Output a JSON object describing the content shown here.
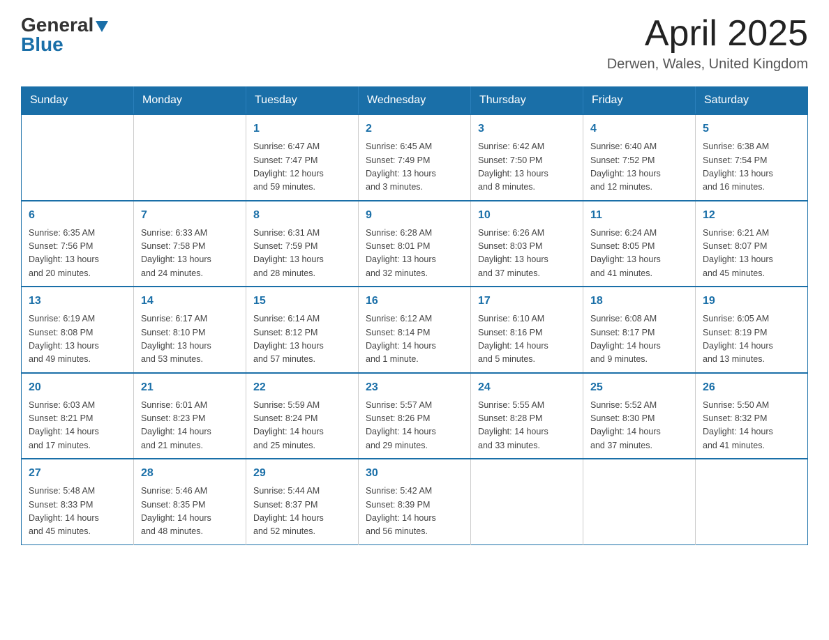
{
  "header": {
    "logo": {
      "general": "General",
      "blue": "Blue"
    },
    "title": "April 2025",
    "location": "Derwen, Wales, United Kingdom"
  },
  "calendar": {
    "days_of_week": [
      "Sunday",
      "Monday",
      "Tuesday",
      "Wednesday",
      "Thursday",
      "Friday",
      "Saturday"
    ],
    "weeks": [
      [
        {
          "day": "",
          "info": ""
        },
        {
          "day": "",
          "info": ""
        },
        {
          "day": "1",
          "info": "Sunrise: 6:47 AM\nSunset: 7:47 PM\nDaylight: 12 hours\nand 59 minutes."
        },
        {
          "day": "2",
          "info": "Sunrise: 6:45 AM\nSunset: 7:49 PM\nDaylight: 13 hours\nand 3 minutes."
        },
        {
          "day": "3",
          "info": "Sunrise: 6:42 AM\nSunset: 7:50 PM\nDaylight: 13 hours\nand 8 minutes."
        },
        {
          "day": "4",
          "info": "Sunrise: 6:40 AM\nSunset: 7:52 PM\nDaylight: 13 hours\nand 12 minutes."
        },
        {
          "day": "5",
          "info": "Sunrise: 6:38 AM\nSunset: 7:54 PM\nDaylight: 13 hours\nand 16 minutes."
        }
      ],
      [
        {
          "day": "6",
          "info": "Sunrise: 6:35 AM\nSunset: 7:56 PM\nDaylight: 13 hours\nand 20 minutes."
        },
        {
          "day": "7",
          "info": "Sunrise: 6:33 AM\nSunset: 7:58 PM\nDaylight: 13 hours\nand 24 minutes."
        },
        {
          "day": "8",
          "info": "Sunrise: 6:31 AM\nSunset: 7:59 PM\nDaylight: 13 hours\nand 28 minutes."
        },
        {
          "day": "9",
          "info": "Sunrise: 6:28 AM\nSunset: 8:01 PM\nDaylight: 13 hours\nand 32 minutes."
        },
        {
          "day": "10",
          "info": "Sunrise: 6:26 AM\nSunset: 8:03 PM\nDaylight: 13 hours\nand 37 minutes."
        },
        {
          "day": "11",
          "info": "Sunrise: 6:24 AM\nSunset: 8:05 PM\nDaylight: 13 hours\nand 41 minutes."
        },
        {
          "day": "12",
          "info": "Sunrise: 6:21 AM\nSunset: 8:07 PM\nDaylight: 13 hours\nand 45 minutes."
        }
      ],
      [
        {
          "day": "13",
          "info": "Sunrise: 6:19 AM\nSunset: 8:08 PM\nDaylight: 13 hours\nand 49 minutes."
        },
        {
          "day": "14",
          "info": "Sunrise: 6:17 AM\nSunset: 8:10 PM\nDaylight: 13 hours\nand 53 minutes."
        },
        {
          "day": "15",
          "info": "Sunrise: 6:14 AM\nSunset: 8:12 PM\nDaylight: 13 hours\nand 57 minutes."
        },
        {
          "day": "16",
          "info": "Sunrise: 6:12 AM\nSunset: 8:14 PM\nDaylight: 14 hours\nand 1 minute."
        },
        {
          "day": "17",
          "info": "Sunrise: 6:10 AM\nSunset: 8:16 PM\nDaylight: 14 hours\nand 5 minutes."
        },
        {
          "day": "18",
          "info": "Sunrise: 6:08 AM\nSunset: 8:17 PM\nDaylight: 14 hours\nand 9 minutes."
        },
        {
          "day": "19",
          "info": "Sunrise: 6:05 AM\nSunset: 8:19 PM\nDaylight: 14 hours\nand 13 minutes."
        }
      ],
      [
        {
          "day": "20",
          "info": "Sunrise: 6:03 AM\nSunset: 8:21 PM\nDaylight: 14 hours\nand 17 minutes."
        },
        {
          "day": "21",
          "info": "Sunrise: 6:01 AM\nSunset: 8:23 PM\nDaylight: 14 hours\nand 21 minutes."
        },
        {
          "day": "22",
          "info": "Sunrise: 5:59 AM\nSunset: 8:24 PM\nDaylight: 14 hours\nand 25 minutes."
        },
        {
          "day": "23",
          "info": "Sunrise: 5:57 AM\nSunset: 8:26 PM\nDaylight: 14 hours\nand 29 minutes."
        },
        {
          "day": "24",
          "info": "Sunrise: 5:55 AM\nSunset: 8:28 PM\nDaylight: 14 hours\nand 33 minutes."
        },
        {
          "day": "25",
          "info": "Sunrise: 5:52 AM\nSunset: 8:30 PM\nDaylight: 14 hours\nand 37 minutes."
        },
        {
          "day": "26",
          "info": "Sunrise: 5:50 AM\nSunset: 8:32 PM\nDaylight: 14 hours\nand 41 minutes."
        }
      ],
      [
        {
          "day": "27",
          "info": "Sunrise: 5:48 AM\nSunset: 8:33 PM\nDaylight: 14 hours\nand 45 minutes."
        },
        {
          "day": "28",
          "info": "Sunrise: 5:46 AM\nSunset: 8:35 PM\nDaylight: 14 hours\nand 48 minutes."
        },
        {
          "day": "29",
          "info": "Sunrise: 5:44 AM\nSunset: 8:37 PM\nDaylight: 14 hours\nand 52 minutes."
        },
        {
          "day": "30",
          "info": "Sunrise: 5:42 AM\nSunset: 8:39 PM\nDaylight: 14 hours\nand 56 minutes."
        },
        {
          "day": "",
          "info": ""
        },
        {
          "day": "",
          "info": ""
        },
        {
          "day": "",
          "info": ""
        }
      ]
    ]
  }
}
